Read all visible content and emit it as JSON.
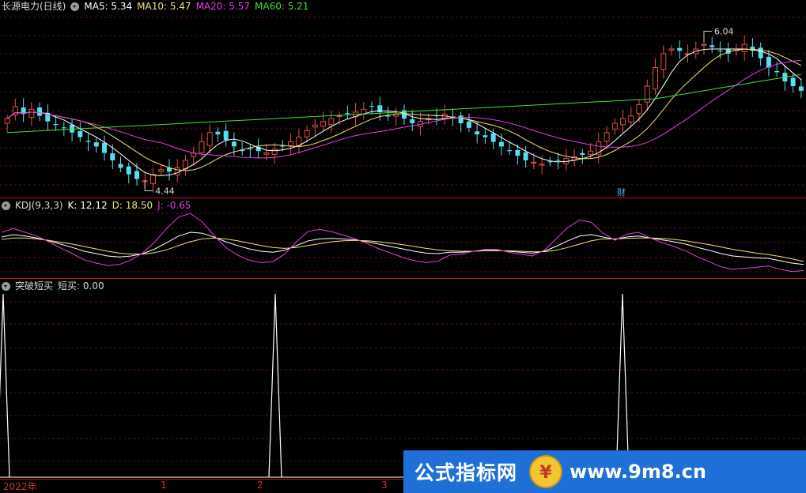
{
  "main_panel": {
    "stock_name": "长源电力(日线)",
    "ma_labels": [
      {
        "text": "MA5: 5.34",
        "color": "#ffffff"
      },
      {
        "text": "MA10: 5.47",
        "color": "#f0e27c"
      },
      {
        "text": "MA20: 5.57",
        "color": "#e040e0"
      },
      {
        "text": "MA60: 5.21",
        "color": "#40e040"
      }
    ],
    "high_marker": "6.04",
    "low_marker": "4.44",
    "finance_tag": "财"
  },
  "kdj_panel": {
    "title": "KDJ(9,3,3)",
    "k_label": "K: 12.12",
    "d_label": "D: 18.50",
    "j_label": "J: -0.65",
    "colors": {
      "k": "#ffffff",
      "d": "#f0e27c",
      "j": "#e040e0"
    }
  },
  "indicator_panel": {
    "title": "突破短买",
    "value_label": "短买: 0.00"
  },
  "date_axis": [
    "2022年",
    "1",
    "2",
    "3"
  ],
  "watermark": {
    "text": "公式指标网",
    "url": "www.9m8.cn",
    "logo_icon": "coin-logo-icon"
  },
  "colors": {
    "up": "#e0504a",
    "down": "#54e0f0",
    "grid": "#5a1010",
    "separator": "#b01919"
  },
  "chart_data": [
    {
      "type": "candlestick",
      "title": "长源电力(日线)",
      "ylim": [
        4.3,
        6.3
      ],
      "series": [
        {
          "name": "MA5",
          "color": "#ffffff"
        },
        {
          "name": "MA10",
          "color": "#f0e27c"
        },
        {
          "name": "MA20",
          "color": "#e040e0"
        },
        {
          "name": "MA60",
          "color": "#40e040"
        }
      ],
      "close": [
        5.15,
        5.28,
        5.2,
        5.25,
        5.18,
        5.12,
        5.08,
        5.05,
        5.0,
        4.95,
        4.9,
        4.85,
        4.78,
        4.7,
        4.62,
        4.55,
        4.5,
        4.48,
        4.55,
        4.6,
        4.58,
        4.62,
        4.7,
        4.78,
        4.9,
        5.0,
        4.98,
        4.92,
        4.85,
        4.8,
        4.82,
        4.8,
        4.78,
        4.82,
        4.85,
        4.9,
        4.95,
        5.02,
        5.08,
        5.12,
        5.15,
        5.18,
        5.2,
        5.22,
        5.25,
        5.28,
        5.22,
        5.18,
        5.2,
        5.15,
        5.1,
        5.12,
        5.15,
        5.18,
        5.2,
        5.15,
        5.1,
        5.05,
        4.98,
        4.95,
        4.9,
        4.85,
        4.8,
        4.75,
        4.7,
        4.68,
        4.66,
        4.68,
        4.7,
        4.72,
        4.74,
        4.76,
        4.8,
        4.9,
        5.0,
        5.1,
        5.15,
        5.18,
        5.3,
        5.5,
        5.7,
        5.85,
        5.9,
        5.88,
        5.85,
        5.9,
        5.95,
        5.92,
        5.88,
        5.85,
        5.9,
        5.95,
        5.88,
        5.8,
        5.7,
        5.65,
        5.55,
        5.5,
        5.45
      ],
      "k": [
        70,
        75,
        72,
        68,
        62,
        55,
        48,
        40,
        35,
        30,
        28,
        30,
        35,
        45,
        58,
        72,
        80,
        78,
        70,
        60,
        52,
        45,
        40,
        38,
        42,
        52,
        62,
        66,
        67,
        66,
        64,
        60,
        55,
        50,
        45,
        40,
        36,
        35,
        38,
        38,
        40,
        42,
        42,
        40,
        38,
        36,
        40,
        50,
        62,
        72,
        75,
        70,
        65,
        70,
        72,
        68,
        64,
        60,
        55,
        48,
        42,
        35,
        30,
        28,
        26,
        25,
        20,
        15,
        12
      ],
      "d": [
        65,
        68,
        68,
        66,
        63,
        59,
        55,
        50,
        45,
        40,
        36,
        34,
        34,
        37,
        43,
        52,
        60,
        66,
        68,
        66,
        62,
        57,
        52,
        48,
        46,
        48,
        52,
        56,
        60,
        62,
        63,
        62,
        60,
        57,
        54,
        50,
        46,
        43,
        41,
        40,
        40,
        41,
        41,
        41,
        40,
        39,
        39,
        42,
        48,
        55,
        62,
        66,
        66,
        67,
        68,
        68,
        67,
        65,
        62,
        58,
        54,
        49,
        44,
        40,
        36,
        33,
        29,
        24,
        18.5
      ],
      "j": [
        80,
        88,
        80,
        72,
        60,
        47,
        35,
        22,
        15,
        10,
        12,
        22,
        37,
        60,
        88,
        112,
        120,
        102,
        74,
        48,
        32,
        21,
        16,
        18,
        34,
        60,
        82,
        86,
        81,
        74,
        66,
        56,
        45,
        36,
        27,
        20,
        16,
        19,
        32,
        34,
        40,
        44,
        44,
        38,
        34,
        30,
        42,
        66,
        90,
        106,
        101,
        78,
        63,
        76,
        80,
        68,
        58,
        50,
        41,
        28,
        18,
        7,
        2,
        4,
        6,
        9,
        2,
        -3,
        -0.65
      ]
    },
    {
      "type": "line",
      "title": "突破短买",
      "series": [
        {
          "name": "短买",
          "values_at_spikes": [
            1,
            1,
            1
          ],
          "last": 0
        }
      ]
    }
  ]
}
